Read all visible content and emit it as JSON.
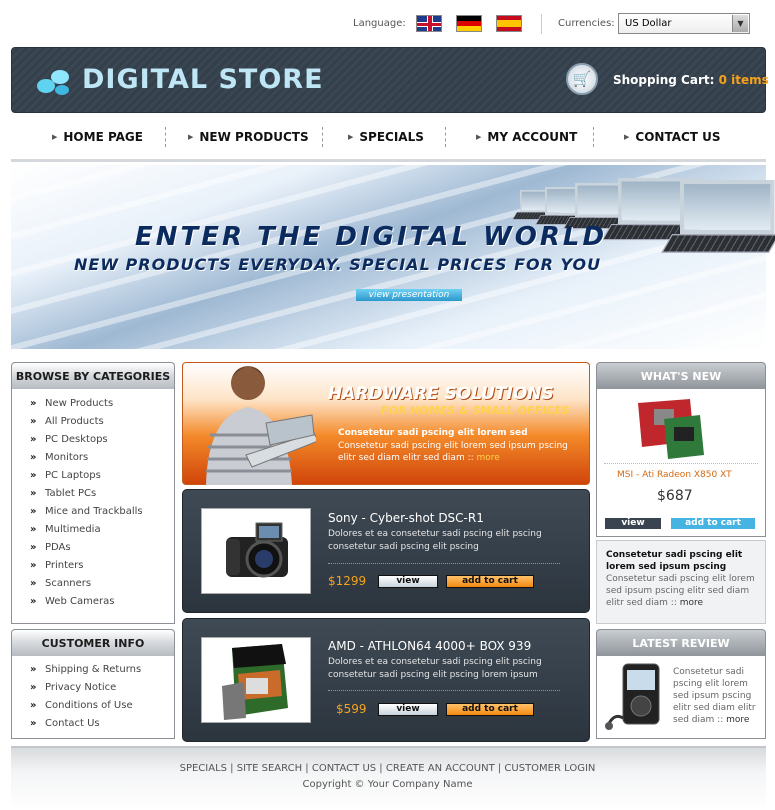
{
  "topbar": {
    "language_label": "Language:",
    "currency_label": "Currencies:",
    "currency_selected": "US Dollar",
    "flags": [
      "uk-flag-icon",
      "germany-flag-icon",
      "spain-flag-icon"
    ]
  },
  "header": {
    "logo_text": "DIGITAL STORE",
    "cart_label": "Shopping Cart:",
    "cart_count": "0 items",
    "accent_color": "#f7a21c"
  },
  "nav": {
    "items": [
      "HOME PAGE",
      "NEW PRODUCTS",
      "SPECIALS",
      "MY ACCOUNT",
      "CONTACT US"
    ]
  },
  "banner": {
    "headline": "ENTER THE DIGITAL WORLD",
    "subline": "NEW PRODUCTS EVERYDAY. SPECIAL PRICES FOR YOU",
    "button": "view presentation"
  },
  "categories": {
    "title": "BROWSE BY CATEGORIES",
    "items": [
      "New Products",
      "All Products",
      "PC Desktops",
      "Monitors",
      "PC Laptops",
      "Tablet PCs",
      "Mice and Trackballs",
      "Multimedia",
      "PDAs",
      "Printers",
      "Scanners",
      "Web Cameras"
    ]
  },
  "customer_info": {
    "title": "CUSTOMER INFO",
    "items": [
      "Shipping & Returns",
      "Privacy Notice",
      "Conditions of Use",
      "Contact Us"
    ]
  },
  "promo": {
    "title": "HARDWARE SOLUTIONS",
    "subtitle": "FOR HOMES & SMALL OFFICES",
    "bold_text": "Consetetur sadi pscing elit lorem sed",
    "text": "Consetetur sadi pscing elit lorem sed  ipsum pscing elitr sed diam elitr sed diam ::",
    "more": "more"
  },
  "products": [
    {
      "title": "Sony - Cyber-shot DSC-R1",
      "desc": "Dolores et ea consetetur sadi pscing elit pscing consetetur sadi pscing elit pscing",
      "price": "$1299",
      "view": "view",
      "cart": "add to cart"
    },
    {
      "title": "AMD - ATHLON64 4000+ BOX 939",
      "desc": "Dolores et ea consetetur sadi pscing elit pscing consetetur sadi pscing elit pscing lorem ipsum",
      "price": "$599",
      "view": "view",
      "cart": "add to cart"
    }
  ],
  "whats_new": {
    "title": "WHAT'S NEW",
    "product_name": "MSI - Ati Radeon X850 XT",
    "price": "$687",
    "view": "view",
    "cart": "add to cart",
    "bold_text": "Consetetur sadi pscing elit lorem sed  ipsum pscing",
    "text": "Consetetur sadi pscing elit lorem sed  ipsum pscing elitr sed diam elitr sed diam ::",
    "more": "more"
  },
  "latest_review": {
    "title": "LATEST REVIEW",
    "text": "Consetetur sadi pscing elit lorem sed  ipsum pscing elitr sed diam elitr sed diam ::",
    "more": "more"
  },
  "footer": {
    "links": [
      "SPECIALS",
      "SITE SEARCH",
      "CONTACT US",
      "CREATE AN ACCOUNT",
      "CUSTOMER LOGIN"
    ],
    "copyright": "Copyright © Your Company Name"
  }
}
